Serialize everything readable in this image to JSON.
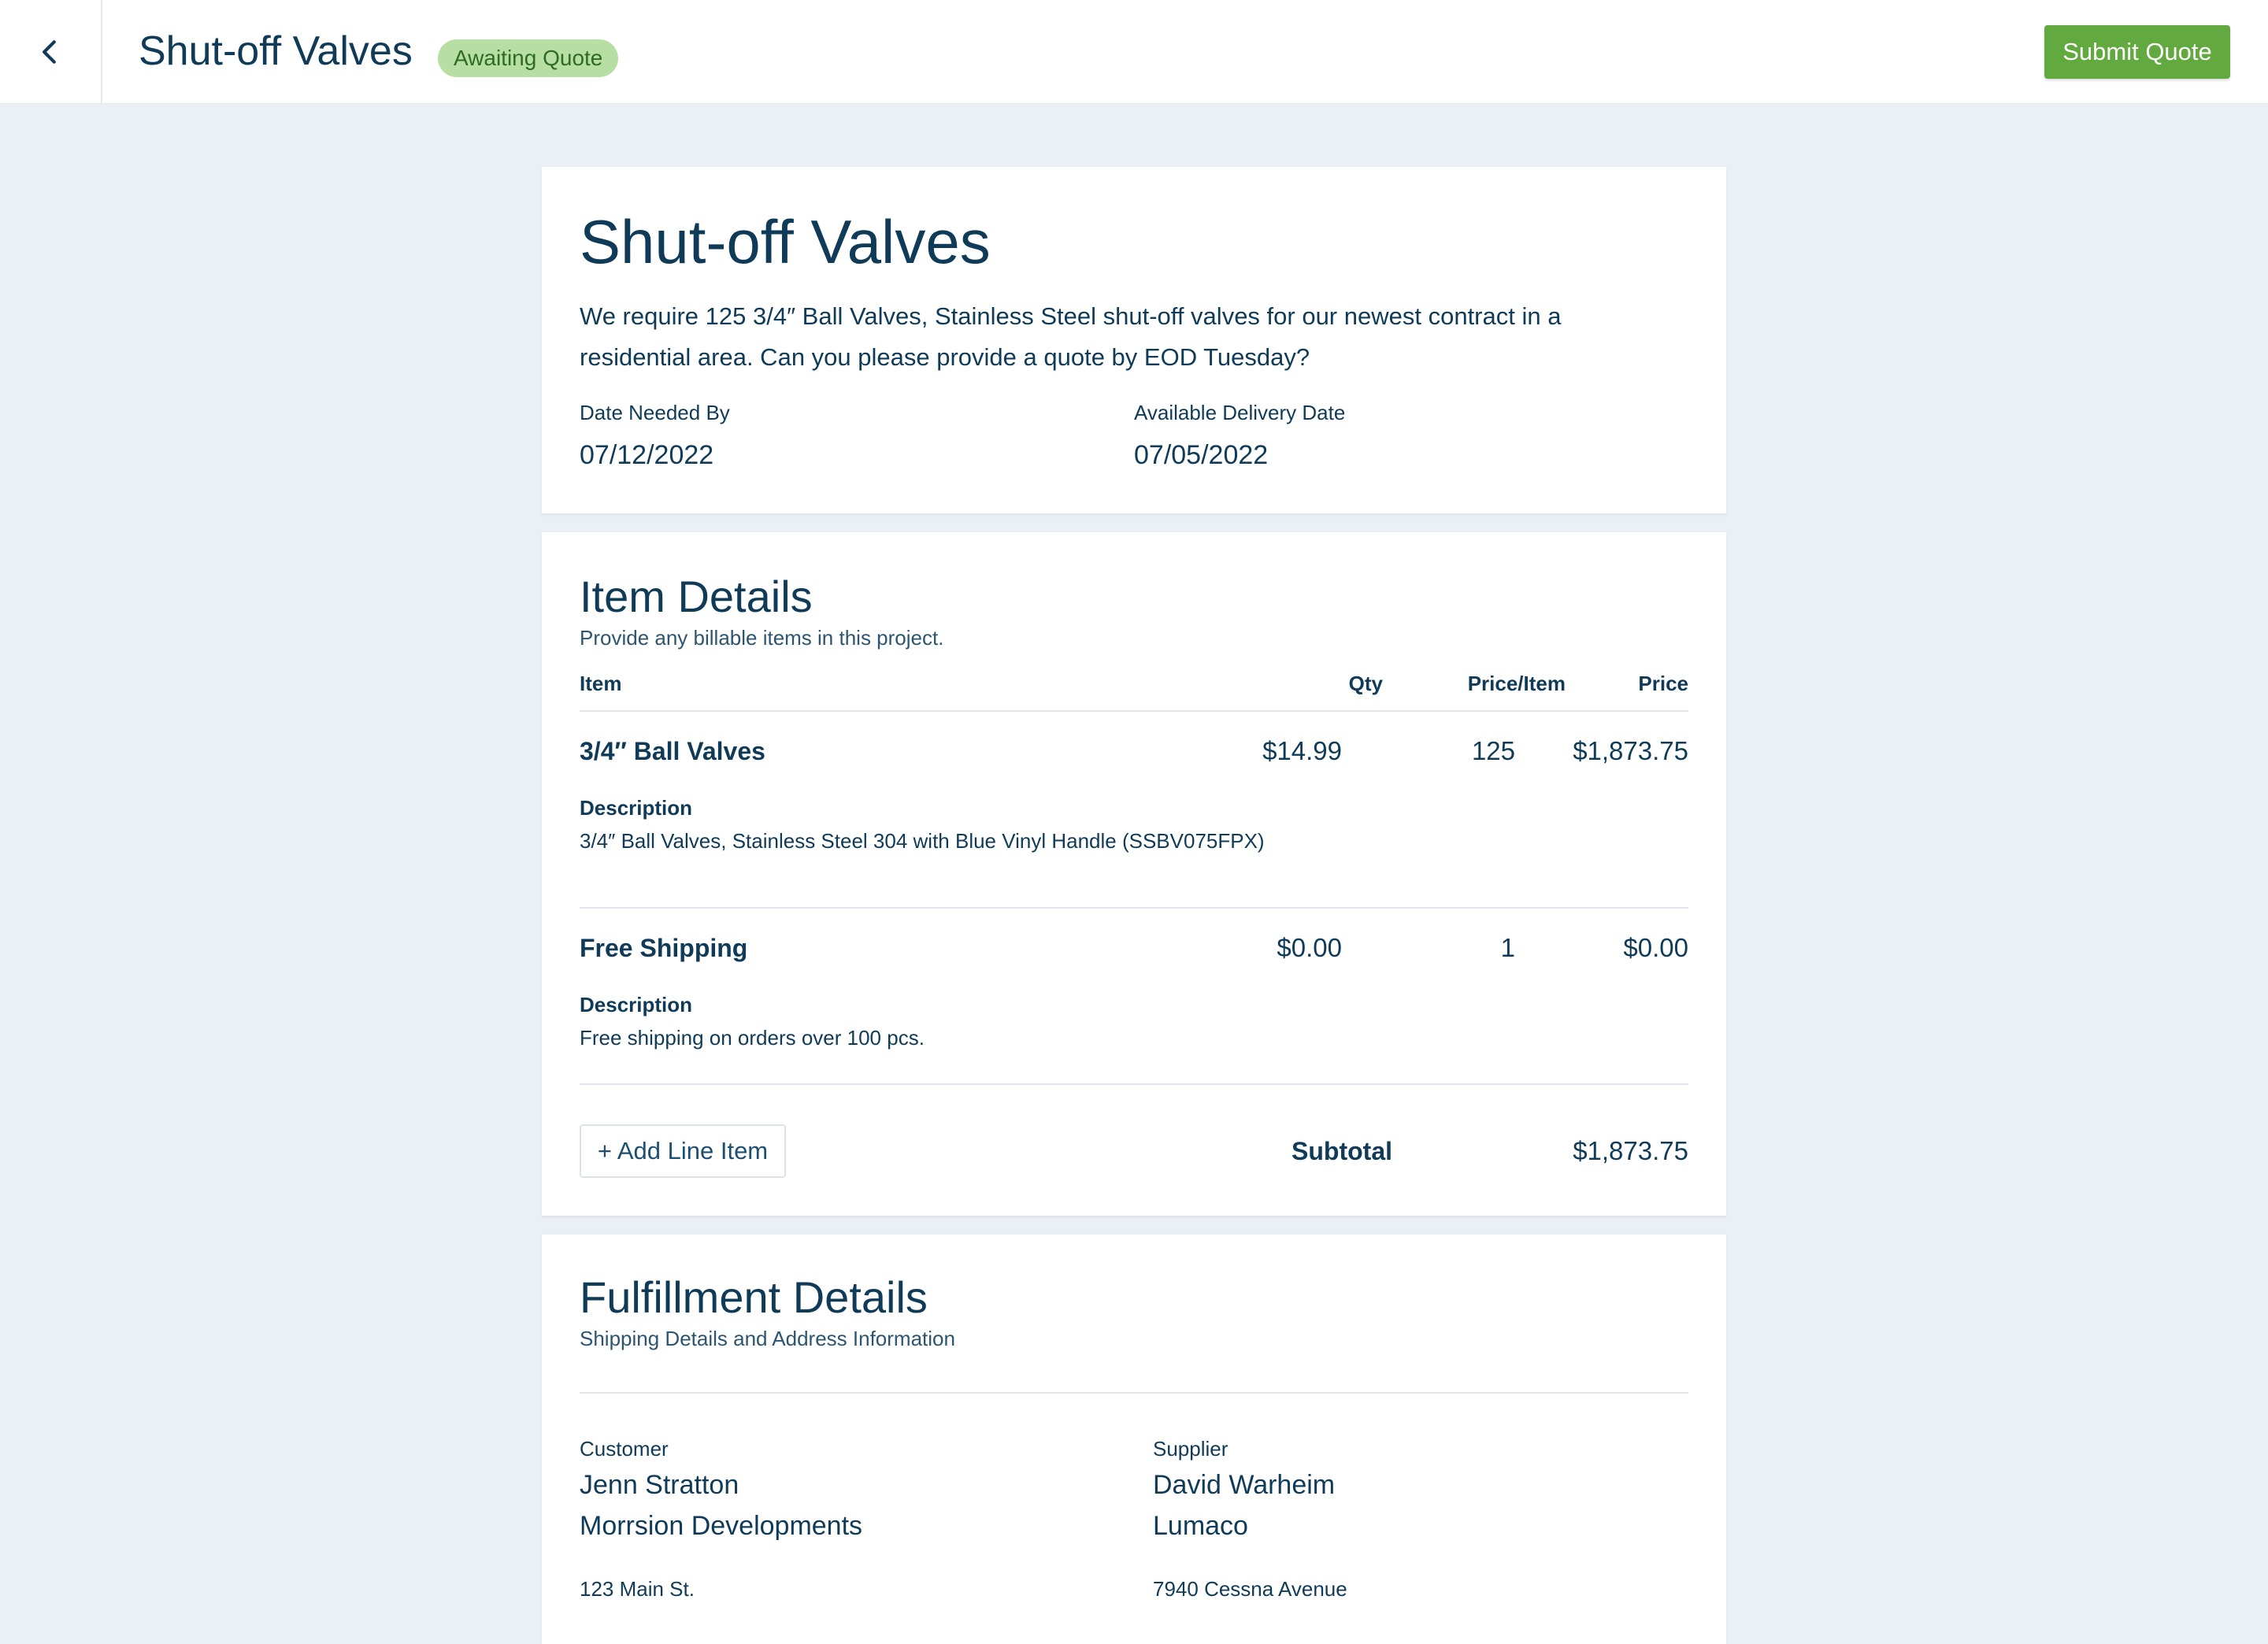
{
  "header": {
    "title": "Shut-off Valves",
    "status": "Awaiting Quote",
    "submit_label": "Submit Quote"
  },
  "request": {
    "title": "Shut-off Valves",
    "description": "We require 125 3/4″ Ball Valves,  Stainless Steel shut-off valves for our newest contract in a residential area. Can you please provide a quote by EOD Tuesday?",
    "date_needed_label": "Date Needed By",
    "date_needed": "07/12/2022",
    "delivery_label": "Available Delivery Date",
    "delivery_date": "07/05/2022"
  },
  "items": {
    "title": "Item Details",
    "subtitle": "Provide any billable items in this project.",
    "columns": [
      "Item",
      "Price/Item",
      "Qty",
      "Price"
    ],
    "rows": [
      {
        "name": "3/4″ Ball Valves",
        "price_item": "$14.99",
        "qty": "125",
        "price": "$1,873.75",
        "desc_label": "Description",
        "desc": "3/4″ Ball Valves, Stainless Steel 304 with Blue Vinyl Handle (SSBV075FPX)"
      },
      {
        "name": "Free Shipping",
        "price_item": "$0.00",
        "qty": "1",
        "price": "$0.00",
        "desc_label": "Description",
        "desc": "Free shipping on orders over 100 pcs."
      }
    ],
    "add_label": "+ Add Line Item",
    "subtotal_label": "Subtotal",
    "subtotal": "$1,873.75"
  },
  "fulfillment": {
    "title": "Fulfillment Details",
    "subtitle": "Shipping Details and Address Information",
    "customer": {
      "label": "Customer",
      "name": "Jenn Stratton",
      "company": "Morrsion Developments",
      "address": "123 Main St."
    },
    "supplier": {
      "label": "Supplier",
      "name": "David Warheim",
      "company": "Lumaco",
      "address": "7940 Cessna Avenue"
    }
  }
}
